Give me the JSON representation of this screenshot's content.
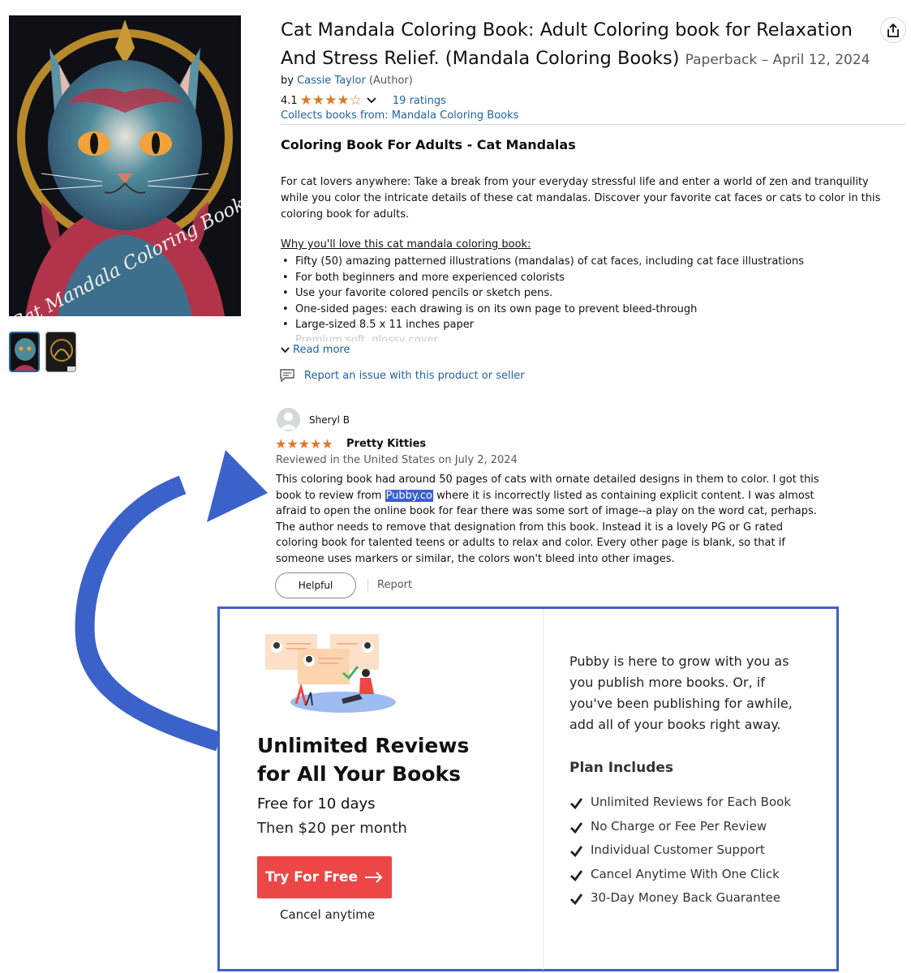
{
  "product": {
    "title": "Cat Mandala Coloring Book: Adult Coloring book for Relaxation And Stress Relief. (Mandala Coloring Books)",
    "format": "Paperback – April 12, 2024",
    "by_label": "by",
    "author": "Cassie Taylor",
    "author_role": "(Author)",
    "rating_value": "4.1",
    "rating_stars": "★★★★☆",
    "ratings_count": "19 ratings",
    "series_text": "Collects books from: Mandala Coloring Books",
    "cover_text": "Cat Mandala Coloring Book",
    "thumbnail_count": 2
  },
  "description": {
    "heading": "Coloring Book For Adults - Cat Mandalas",
    "intro": "For cat lovers anywhere: Take a break from your everyday stressful life and enter a world of zen and tranquility while you color the intricate details of these cat mandalas. Discover your favorite cat faces or cats to color in this coloring book for adults.",
    "why_heading": "Why you'll love this cat mandala coloring book:",
    "bullets": [
      "Fifty (50) amazing patterned illustrations (mandalas) of cat faces, including cat face illustrations",
      "For both beginners and more experienced colorists",
      "Use your favorite colored pencils or sketch pens.",
      "One-sided pages: each drawing is on its own page to prevent bleed-through",
      "Large-sized 8.5 x 11 inches paper"
    ],
    "faded_bullet": "Premium soft, glossy cover",
    "read_more": "Read more",
    "report_issue": "Report an issue with this product or seller"
  },
  "review": {
    "reviewer": "Sheryl B",
    "stars": "★★★★★",
    "title": "Pretty Kitties",
    "meta": "Reviewed in the United States on July 2, 2024",
    "body_before": "This coloring book had around 50 pages of cats with ornate detailed designs in them to color. I got this book to review from ",
    "body_highlight": "Pubby.co",
    "body_after": " where it is incorrectly listed as containing explicit content. I was almost afraid to open the online book for fear there was some sort of image--a play on the word cat, perhaps. The author needs to remove that designation from this book. Instead it is a lovely PG or G rated coloring book for talented teens or adults to relax and color. Every other page is blank, so that if someone uses markers or similar, the colors won't bleed into other images.",
    "helpful_label": "Helpful",
    "report_label": "Report"
  },
  "promo": {
    "title_line1": "Unlimited Reviews",
    "title_line2": "for All Your Books",
    "free_text": "Free for 10 days",
    "price_text": "Then $20 per month",
    "cta_label": "Try For Free",
    "cancel_text": "Cancel anytime",
    "pitch": "Pubby is here to grow with you as you publish more books. Or, if you've been publishing for awhile, add all of your books right away.",
    "plan_heading": "Plan Includes",
    "plan_items": [
      "Unlimited Reviews for Each Book",
      "No Charge or Fee Per Review",
      "Individual Customer Support",
      "Cancel Anytime With One Click",
      "30-Day Money Back Guarantee"
    ]
  },
  "colors": {
    "link": "#2162a1",
    "star": "#de7921",
    "arrow": "#3b62c9",
    "cta": "#ec4646",
    "highlight": "#3b5fce"
  },
  "icons": [
    "share-icon",
    "chevron-down-icon",
    "report-icon",
    "user-avatar-icon",
    "check-icon",
    "arrow-right-icon",
    "curved-arrow"
  ]
}
